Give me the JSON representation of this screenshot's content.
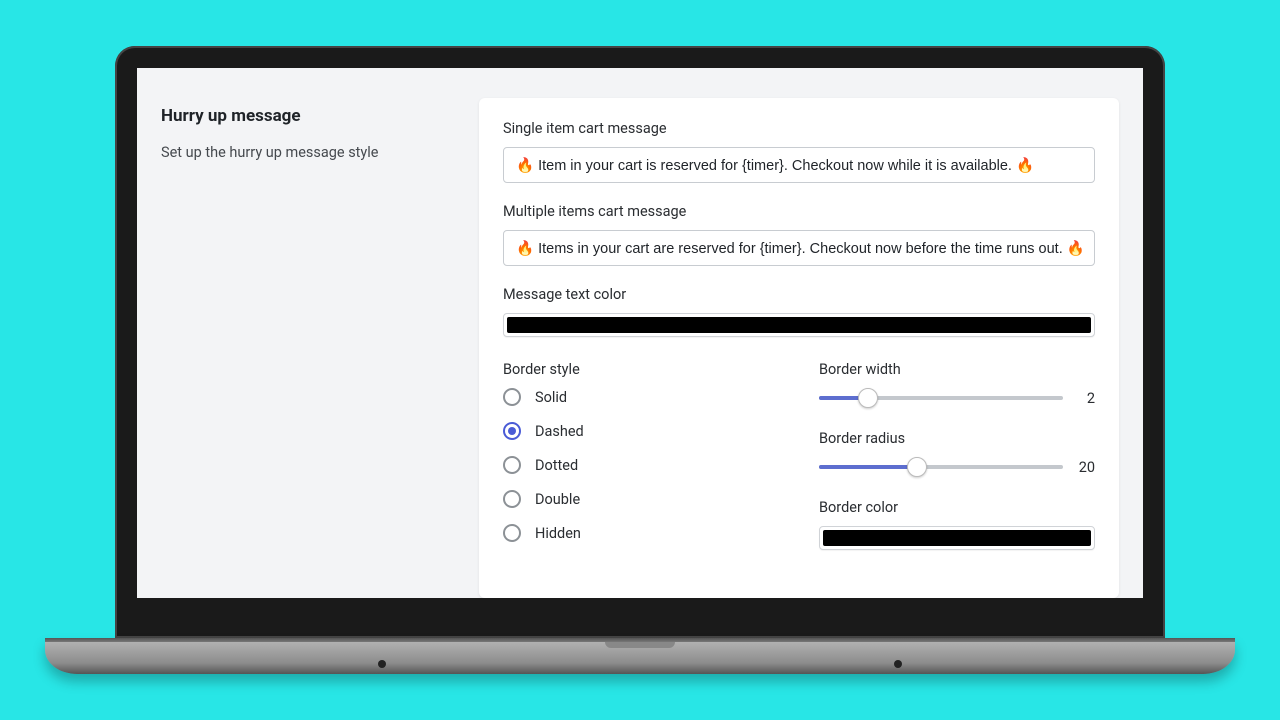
{
  "sidebar": {
    "title": "Hurry up message",
    "description": "Set up the hurry up message style"
  },
  "fields": {
    "single_label": "Single item cart message",
    "single_value": "🔥 Item in your cart is reserved for {timer}. Checkout now while it is available. 🔥",
    "multi_label": "Multiple items cart message",
    "multi_value": "🔥 Items in your cart are reserved for {timer}. Checkout now before the time runs out. 🔥",
    "text_color_label": "Message text color",
    "text_color_value": "#000000"
  },
  "border_style": {
    "label": "Border style",
    "options": [
      "Solid",
      "Dashed",
      "Dotted",
      "Double",
      "Hidden"
    ],
    "selected": "Dashed"
  },
  "border_width": {
    "label": "Border width",
    "value": 2,
    "min": 0,
    "max": 10
  },
  "border_radius": {
    "label": "Border radius",
    "value": 20,
    "min": 0,
    "max": 50
  },
  "border_color": {
    "label": "Border color",
    "value": "#000000"
  }
}
